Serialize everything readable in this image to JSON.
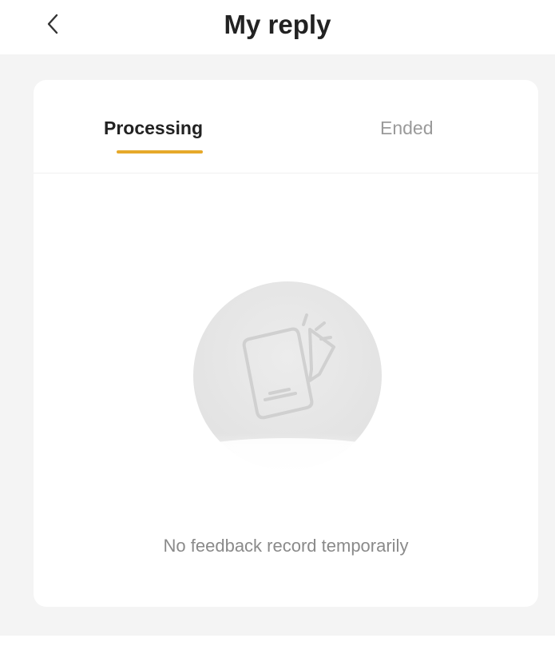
{
  "header": {
    "title": "My reply",
    "back_icon": "chevron-left-icon"
  },
  "tabs": [
    {
      "label": "Processing",
      "active": true
    },
    {
      "label": "Ended",
      "active": false
    }
  ],
  "empty_state": {
    "message": "No feedback record temporarily",
    "icon": "notepad-pencil-icon"
  },
  "colors": {
    "accent": "#e6a92a",
    "background": "#f4f4f4",
    "card": "#ffffff"
  }
}
